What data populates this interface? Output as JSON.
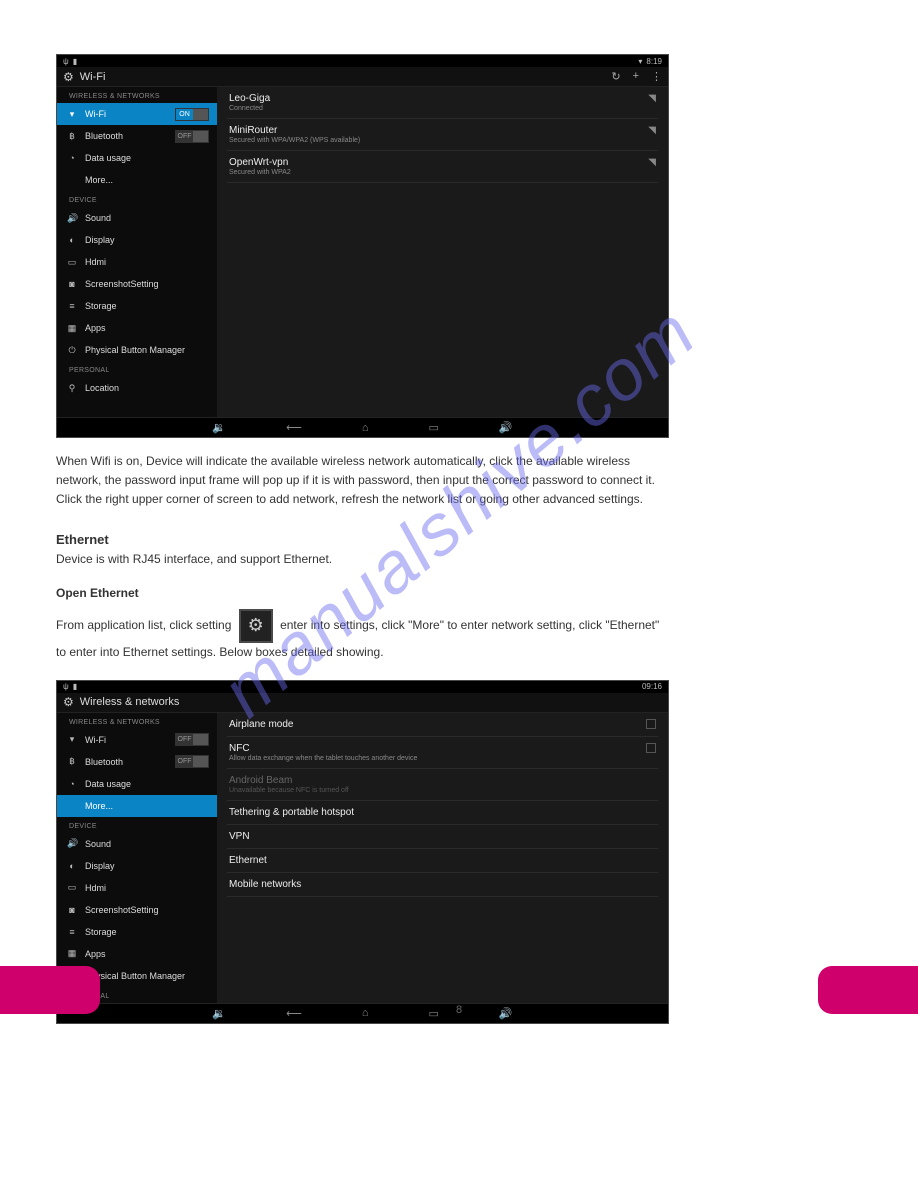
{
  "watermark": "manualshive.com",
  "pageNumber": "8",
  "shot1": {
    "status": {
      "time": "8:19"
    },
    "title": "Wi-Fi",
    "sidebar": {
      "sections": [
        {
          "header": "WIRELESS & NETWORKS"
        },
        {
          "header": "DEVICE"
        },
        {
          "header": "PERSONAL"
        }
      ],
      "items": {
        "wifi": {
          "label": "Wi-Fi",
          "switch": "ON"
        },
        "bt": {
          "label": "Bluetooth",
          "switch": "OFF"
        },
        "data": {
          "label": "Data usage"
        },
        "more": {
          "label": "More..."
        },
        "sound": {
          "label": "Sound"
        },
        "display": {
          "label": "Display"
        },
        "hdmi": {
          "label": "Hdmi"
        },
        "shot": {
          "label": "ScreenshotSetting"
        },
        "storage": {
          "label": "Storage"
        },
        "apps": {
          "label": "Apps"
        },
        "pbm": {
          "label": "Physical Button Manager"
        },
        "location": {
          "label": "Location"
        }
      }
    },
    "networks": [
      {
        "name": "Leo-Giga",
        "sub": "Connected"
      },
      {
        "name": "MiniRouter",
        "sub": "Secured with WPA/WPA2 (WPS available)"
      },
      {
        "name": "OpenWrt-vpn",
        "sub": "Secured with WPA2"
      }
    ]
  },
  "text": {
    "para1": "When Wifi is on, Device will indicate the available wireless network automatically, click the available wireless network, the password input frame will pop up if it is with password, then input the correct password to connect it. Click the right upper corner of screen to add network, refresh the network list or going other advanced settings.",
    "heading": "Ethernet",
    "para2": "Device is with RJ45 interface, and support Ethernet.",
    "sub": "Open Ethernet",
    "para3_a": "From application list, click setting ",
    "para3_b": " enter into settings, click \"More\" to enter network setting, click \"Ethernet\" to enter into Ethernet settings. Below boxes detailed showing."
  },
  "shot2": {
    "status": {
      "time": "09:16"
    },
    "title": "Wireless & networks",
    "sidebar": {
      "sections": [
        {
          "header": "WIRELESS & NETWORKS"
        },
        {
          "header": "DEVICE"
        },
        {
          "header": "PERSONAL"
        }
      ],
      "items": {
        "wifi": {
          "label": "Wi-Fi",
          "switch": "OFF"
        },
        "bt": {
          "label": "Bluetooth",
          "switch": "OFF"
        },
        "data": {
          "label": "Data usage"
        },
        "more": {
          "label": "More..."
        },
        "sound": {
          "label": "Sound"
        },
        "display": {
          "label": "Display"
        },
        "hdmi": {
          "label": "Hdmi"
        },
        "shot": {
          "label": "ScreenshotSetting"
        },
        "storage": {
          "label": "Storage"
        },
        "apps": {
          "label": "Apps"
        },
        "pbm": {
          "label": "Physical Button Manager"
        }
      }
    },
    "options": {
      "airplane": {
        "label": "Airplane mode"
      },
      "nfc": {
        "label": "NFC",
        "sub": "Allow data exchange when the tablet touches another device"
      },
      "beam": {
        "label": "Android Beam",
        "sub": "Unavailable because NFC is turned off"
      },
      "tether": {
        "label": "Tethering & portable hotspot"
      },
      "vpn": {
        "label": "VPN"
      },
      "eth": {
        "label": "Ethernet"
      },
      "mobile": {
        "label": "Mobile networks"
      }
    }
  }
}
